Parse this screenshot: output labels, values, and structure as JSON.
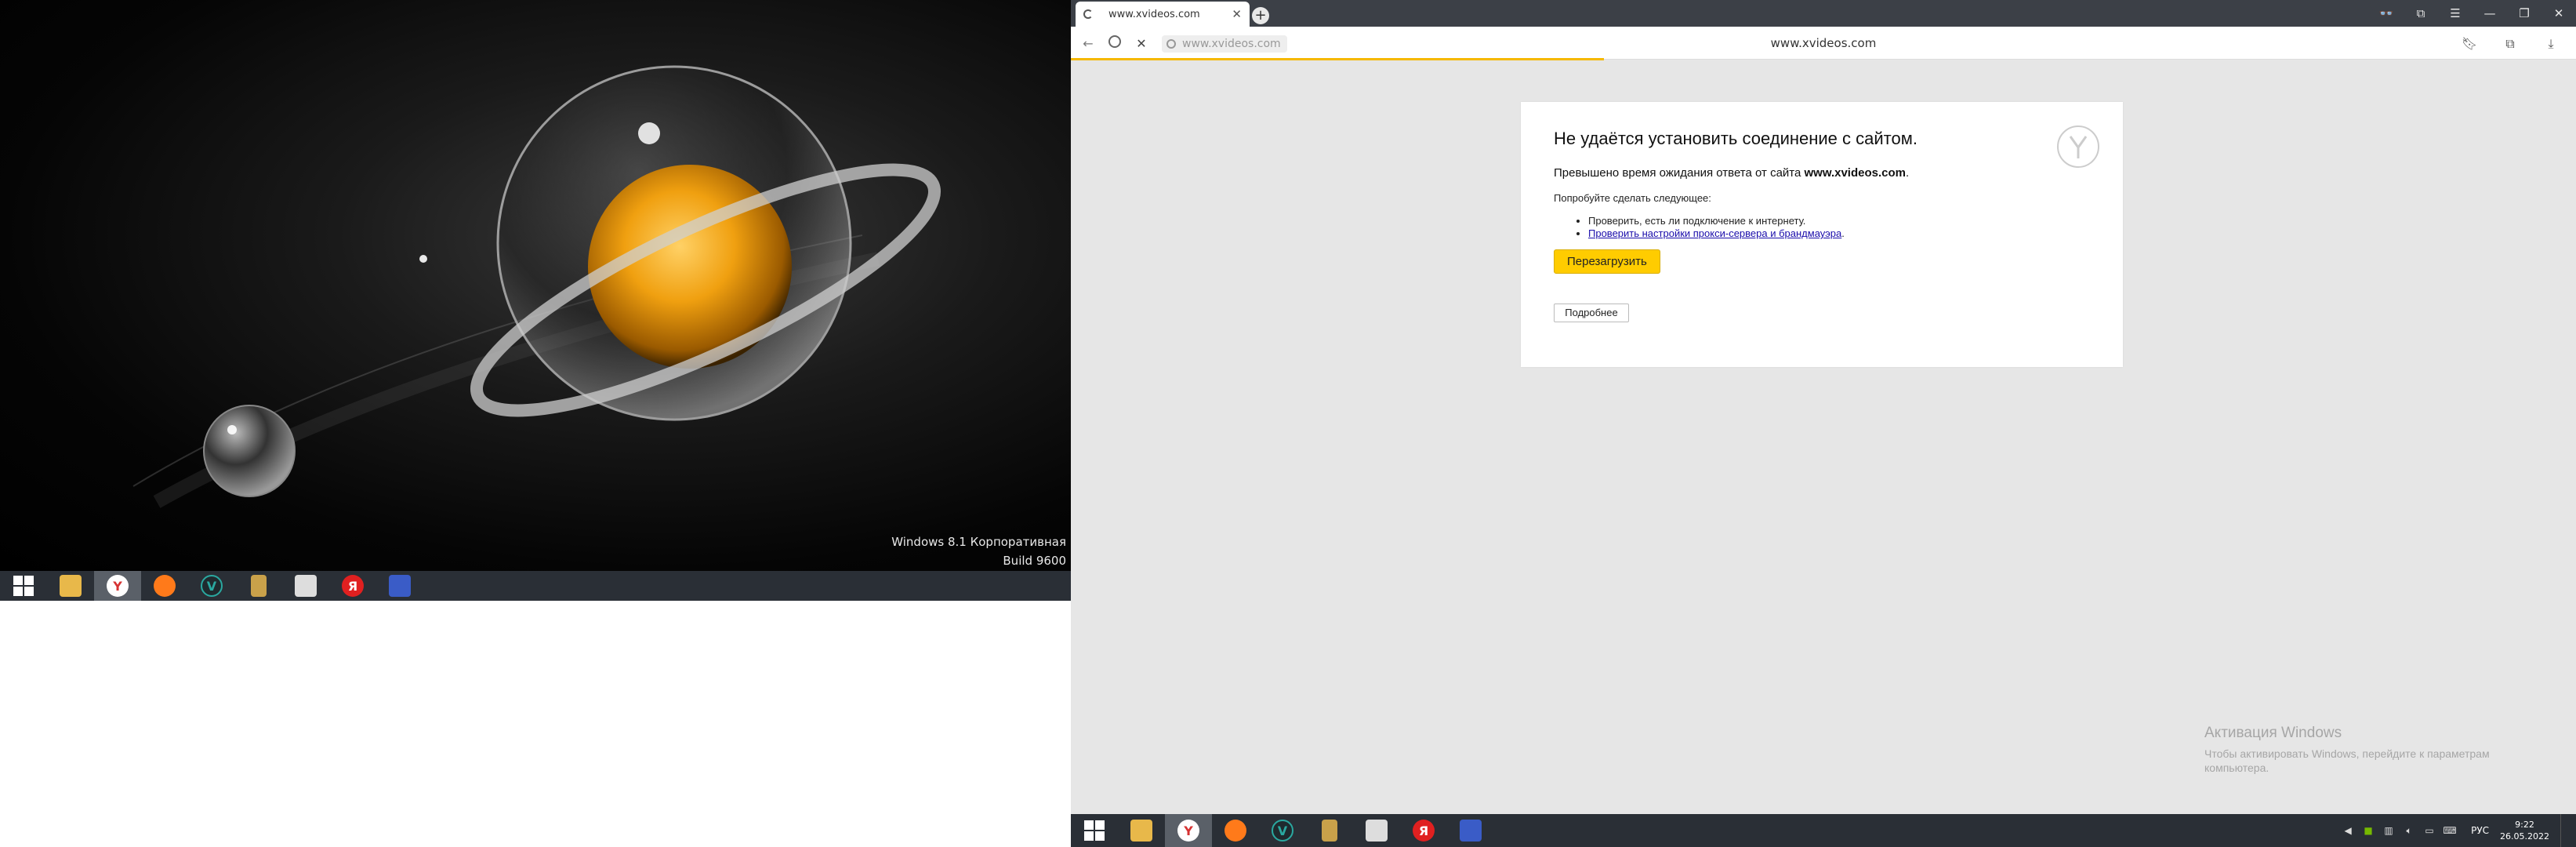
{
  "desktop": {
    "edition": "Windows 8.1 Корпоративная",
    "build": "Build 9600"
  },
  "taskbar_items": [
    {
      "name": "start",
      "icon": "windows-start-icon"
    },
    {
      "name": "explorer",
      "icon": "file-explorer-icon",
      "color": "#e8b84a"
    },
    {
      "name": "yandex-browser",
      "icon": "yandex-browser-icon",
      "color": "#d63232",
      "active": true
    },
    {
      "name": "firefox",
      "icon": "firefox-icon",
      "color": "#ff7a1a"
    },
    {
      "name": "app-v",
      "icon": "v-app-icon",
      "color": "#2aa8a0"
    },
    {
      "name": "archive",
      "icon": "archive-icon",
      "color": "#c9a14a"
    },
    {
      "name": "photo-app",
      "icon": "photo-app-icon",
      "color": "#dddddd"
    },
    {
      "name": "yandex",
      "icon": "yandex-letter-icon",
      "color": "#e02020",
      "letter": "Я"
    },
    {
      "name": "app-blue",
      "icon": "blue-app-icon",
      "color": "#3a5cc7"
    }
  ],
  "browser": {
    "tab_title": "www.xvideos.com",
    "url_pill": "www.xvideos.com",
    "center_url": "www.xvideos.com",
    "window_controls": [
      "👓",
      "⧉",
      "☰",
      "—",
      "❐",
      "✕"
    ],
    "right_tools": [
      "bookmark-icon",
      "extensions-icon",
      "download-icon"
    ]
  },
  "error": {
    "title": "Не удаётся установить соединение с сайтом.",
    "desc_prefix": "Превышено время ожидания ответа от сайта ",
    "desc_site": "www.xvideos.com",
    "desc_suffix": ".",
    "suggest_label": "Попробуйте сделать следующее:",
    "suggest_1": "Проверить, есть ли подключение к интернету.",
    "suggest_2": "Проверить настройки прокси-сервера и брандмауэра",
    "suggest_2_suffix": ".",
    "reload_label": "Перезагрузить",
    "details_label": "Подробнее"
  },
  "activation": {
    "title": "Активация Windows",
    "subtitle": "Чтобы активировать Windows, перейдите к параметрам компьютера."
  },
  "tray": {
    "lang": "РУС",
    "time": "9:22",
    "date": "26.05.2022"
  },
  "colors": {
    "accent": "#ffcc00",
    "loading": "#f5b800",
    "taskbar": "#2a2f36",
    "titlebar": "#3c4047"
  }
}
